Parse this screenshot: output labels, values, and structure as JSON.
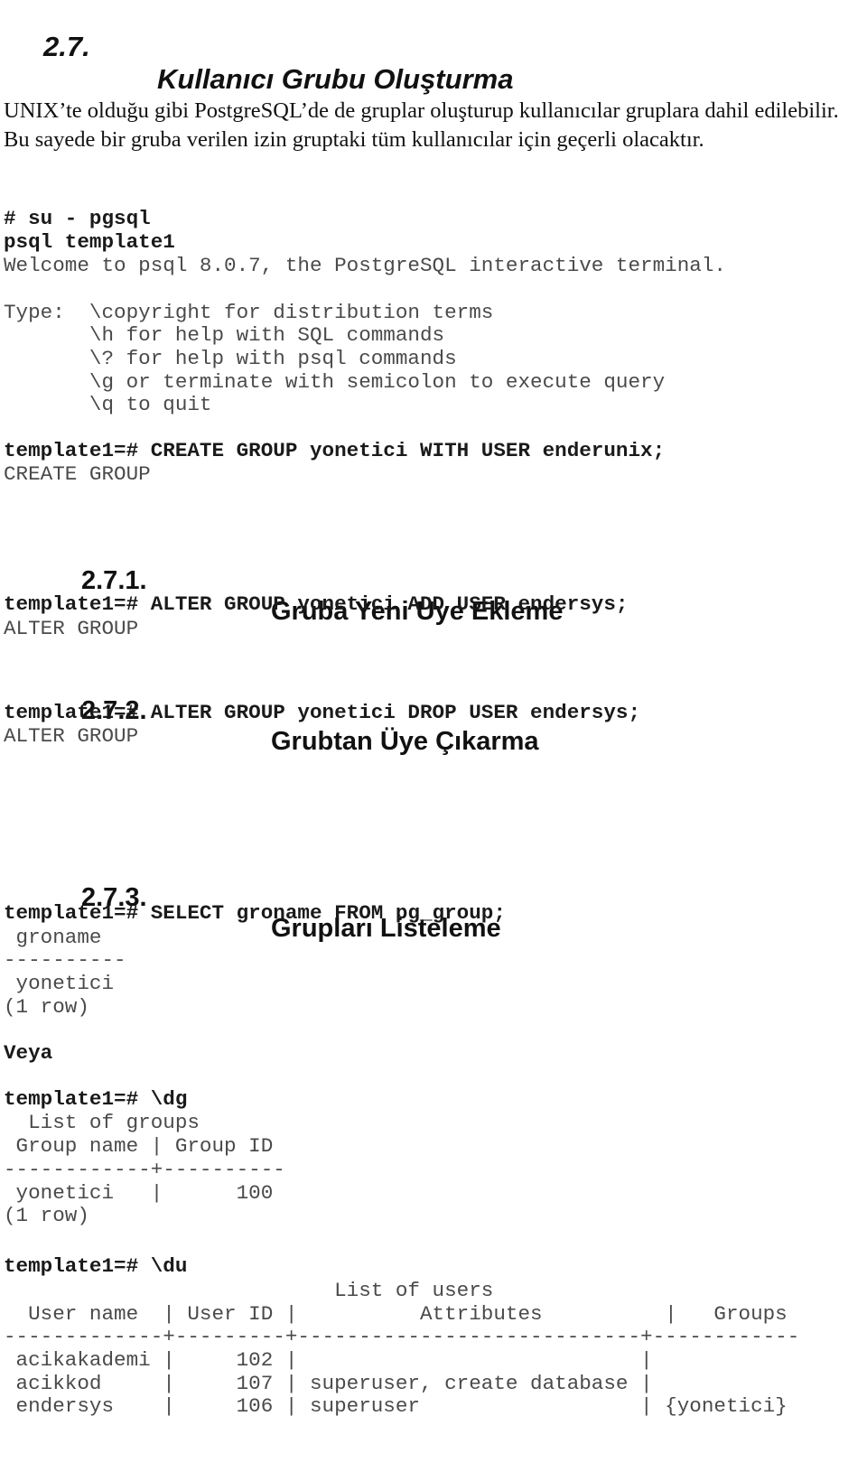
{
  "section": {
    "number": "2.7.",
    "title": "Kullanıcı Grubu Oluşturma",
    "intro": "UNIX’te olduğu gibi PostgreSQL’de de gruplar oluşturup kullanıcılar gruplara dahil edilebilir. Bu sayede bir gruba verilen izin gruptaki tüm kullanıcılar için geçerli olacaktır."
  },
  "session": {
    "cmd_su": "# su - pgsql",
    "cmd_psql": "psql template1",
    "welcome": "Welcome to psql 8.0.7, the PostgreSQL interactive terminal.",
    "help_lines": [
      "Type:  \\copyright for distribution terms",
      "       \\h for help with SQL commands",
      "       \\? for help with psql commands",
      "       \\g or terminate with semicolon to execute query",
      "       \\q to quit"
    ],
    "create_cmd": "template1=# CREATE GROUP yonetici WITH USER enderunix;",
    "create_out": "CREATE GROUP"
  },
  "subsections": [
    {
      "number": "2.7.1.",
      "title": "Gruba Yeni Üye Ekleme",
      "cmd": "template1=# ALTER GROUP yonetici ADD USER endersys;",
      "out": "ALTER GROUP"
    },
    {
      "number": "2.7.2.",
      "title": "Grubtan Üye Çıkarma",
      "cmd": "template1=# ALTER GROUP yonetici DROP USER endersys;",
      "out": "ALTER GROUP"
    },
    {
      "number": "2.7.3.",
      "title": "Grupları Listeleme",
      "cmd": "template1=# SELECT groname FROM pg_group;",
      "output_lines": [
        " groname",
        "----------",
        " yonetici",
        "(1 row)"
      ],
      "or_label": "Veya",
      "dg_cmd": "template1=# \\dg",
      "dg_output": [
        "  List of groups",
        " Group name | Group ID",
        "------------+----------",
        " yonetici   |      100",
        "(1 row)"
      ],
      "du_cmd": "template1=# \\du",
      "du_output": [
        "                           List of users",
        "  User name  | User ID |          Attributes          |   Groups",
        "-------------+---------+----------------------------+------------",
        " acikakademi |     102 |                            |",
        " acikkod     |     107 | superuser, create database |",
        " endersys    |     106 | superuser                  | {yonetici}"
      ]
    }
  ]
}
